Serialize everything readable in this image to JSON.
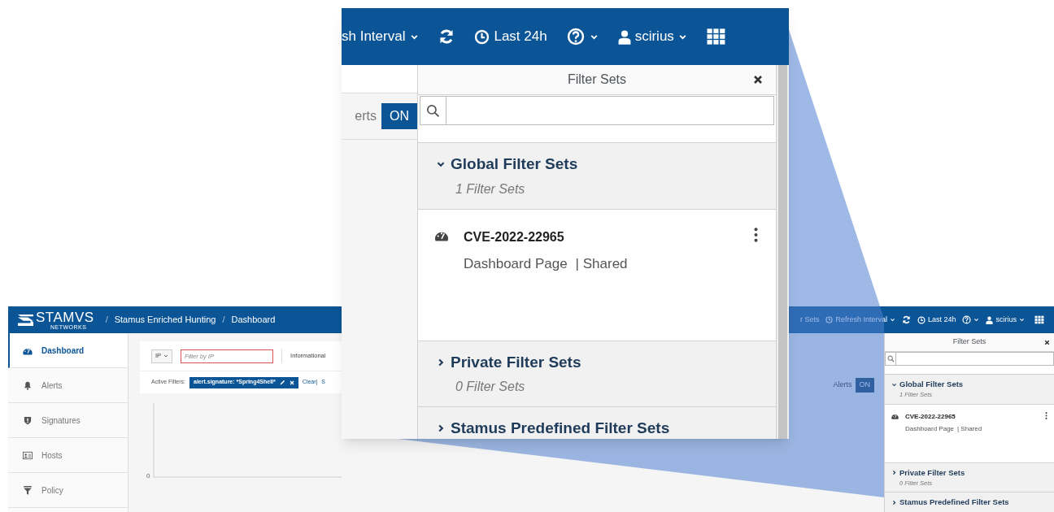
{
  "main_screen": {
    "header": {
      "brand": "STAMVS",
      "brand_sub": "NETWORKS",
      "separator": "/",
      "breadcrumbs": [
        "Stamus Enriched Hunting",
        "Dashboard"
      ],
      "partial_label": "r Sets",
      "refresh_interval": "Refresh Interval",
      "time_range": "Last 24h",
      "user": "scirius"
    },
    "sidebar": {
      "items": [
        {
          "label": "Dashboard",
          "selected": true
        },
        {
          "label": "Alerts",
          "selected": false
        },
        {
          "label": "Signatures",
          "selected": false
        },
        {
          "label": "Hosts",
          "selected": false
        },
        {
          "label": "Policy",
          "selected": false
        }
      ]
    },
    "filter_bar": {
      "type_select": "IP",
      "placeholder": "Filter by IP",
      "severity": "Informational",
      "active_filters_label": "Active Filters:",
      "active_filter": "alert.signature: *Spring4Shell*",
      "clear": "Clear|",
      "next": "S"
    },
    "chart_axis_label": "0",
    "alerts_toggle": {
      "label": "Alerts",
      "value": "ON"
    },
    "filter_sets_panel": {
      "title": "Filter Sets",
      "sections": [
        {
          "title": "Global Filter Sets",
          "count": "1 Filter Sets",
          "expanded": true,
          "items": [
            {
              "name": "CVE-2022-22965",
              "page": "Dashboard Page",
              "shared": "| Shared"
            }
          ]
        },
        {
          "title": "Private Filter Sets",
          "count": "0 Filter Sets",
          "expanded": false
        },
        {
          "title": "Stamus Predefined Filter Sets",
          "expanded": false
        }
      ]
    }
  },
  "zoom_callout": {
    "header": {
      "refresh_interval": "sh Interval",
      "time_range": "Last 24h",
      "user": "scirius"
    },
    "alerts_toggle": {
      "label": "erts",
      "value": "ON"
    },
    "filter_sets_panel": {
      "title": "Filter Sets",
      "sections": [
        {
          "title": "Global Filter Sets",
          "count": "1 Filter Sets",
          "expanded": true,
          "items": [
            {
              "name": "CVE-2022-22965",
              "page": "Dashboard Page",
              "shared": "| Shared"
            }
          ]
        },
        {
          "title": "Private Filter Sets",
          "count": "0 Filter Sets",
          "expanded": false
        },
        {
          "title": "Stamus Predefined Filter Sets",
          "expanded": false
        }
      ]
    }
  }
}
